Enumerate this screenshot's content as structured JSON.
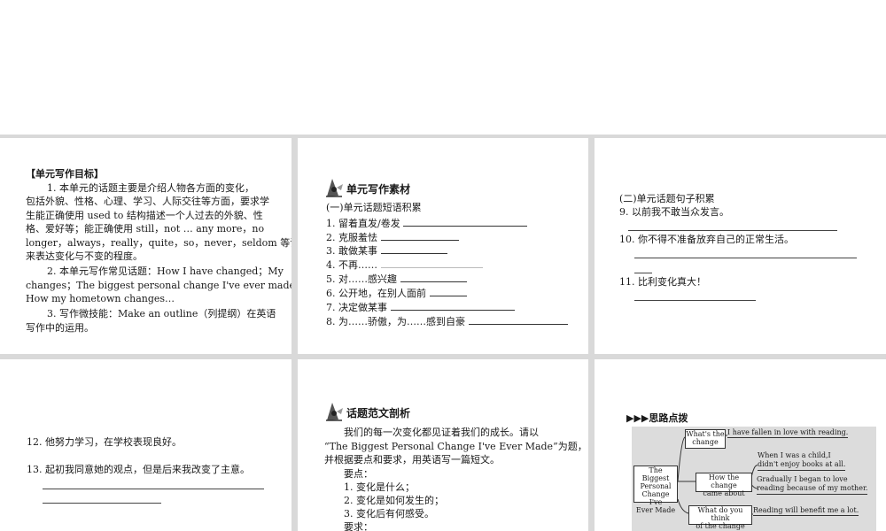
{
  "panel1": {
    "heading": "【单元写作目标】",
    "lines": [
      "1. 本单元的话题主要是介绍人物各方面的变化，",
      "包括外貌、性格、心理、学习、人际交往等方面，要求学",
      "生能正确使用 used to 结构描述一个人过去的外貌、性",
      "格、爱好等；能正确使用 still，not … any more，no",
      "longer，always，really，quite，so，never，seldom 等词语",
      "来表达变化与不变的程度。",
      "2. 本单元写作常见话题：How I have changed；My",
      "changes；The biggest personal change I've ever made；",
      "How my hometown changes…",
      "3. 写作微技能：Make an outline（列提纲）在英语",
      "写作中的运用。"
    ]
  },
  "panel2": {
    "title": "单元写作素材",
    "subheading": "(一)单元话题短语积累",
    "items": [
      "1. 留着直发/卷发",
      "2. 克服羞怯",
      "3. 敢做某事",
      "4. 不再……",
      "5. 对……感兴趣",
      "6. 公开地，在别人面前",
      "7. 决定做某事",
      "8. 为……骄傲，为……感到自豪"
    ]
  },
  "panel3": {
    "subheading": "(二)单元话题句子积累",
    "items": [
      "9. 以前我不敢当众发言。",
      "10. 你不得不准备放弃自己的正常生活。",
      "11. 比利变化真大！"
    ]
  },
  "panel4": {
    "items": [
      "12. 他努力学习，在学校表现良好。",
      "13. 起初我同意她的观点，但是后来我改变了主意。"
    ]
  },
  "panel5": {
    "title": "话题范文剖析",
    "lines": [
      "我们的每一次变化都见证着我们的成长。请以",
      "“The Biggest Personal Change I've Ever Made”为题，",
      "并根据要点和要求，用英语写一篇短文。",
      "要点：",
      "1. 变化是什么；",
      "2. 变化是如何发生的；",
      "3. 变化后有何感受。",
      "要求："
    ]
  },
  "panel6": {
    "heading": "▶▶▶思路点拨",
    "center": [
      "The Biggest",
      "Personal",
      "Change I've",
      "Ever Made"
    ],
    "branches": [
      {
        "label": [
          "What's the",
          "change"
        ],
        "leaves": [
          "I have fallen in love with reading."
        ]
      },
      {
        "label": [
          "How the change",
          "came about"
        ],
        "leaves": [
          "When I was a child,I|didn't enjoy books at all.",
          "Gradually I began to love|reading because of my mother."
        ]
      },
      {
        "label": [
          "What do you think",
          "of the change"
        ],
        "leaves": [
          "Reading will benefit me a lot."
        ]
      }
    ]
  }
}
